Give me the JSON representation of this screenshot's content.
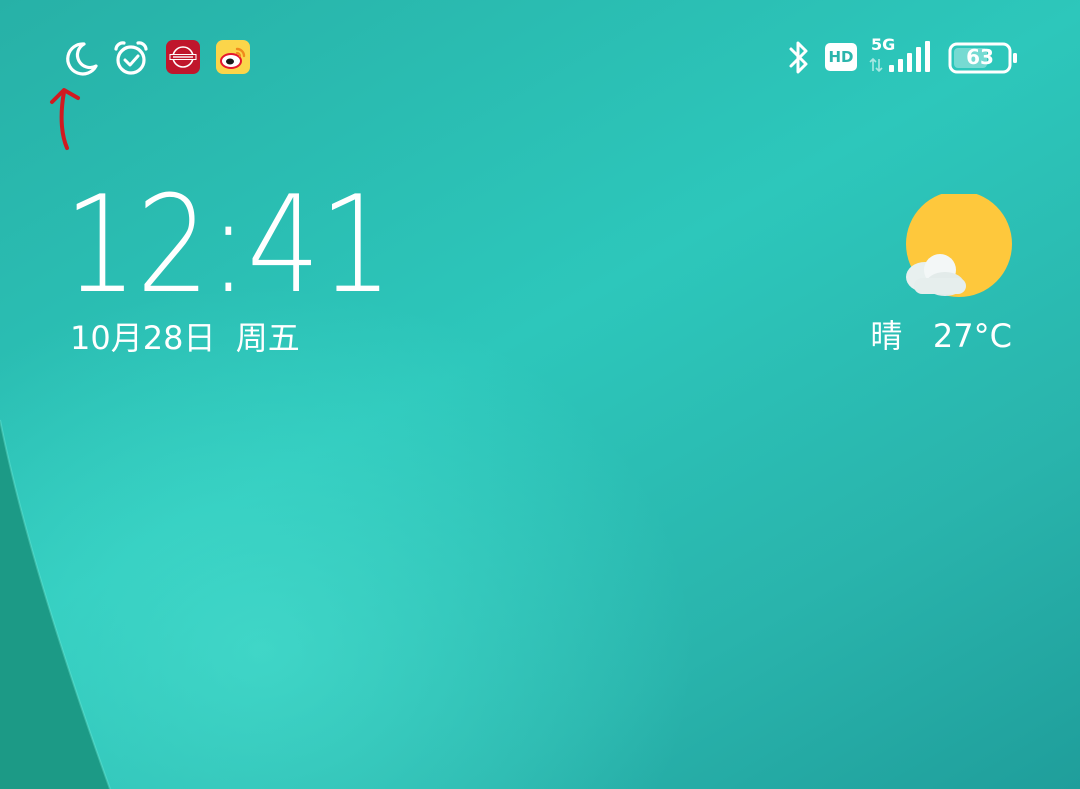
{
  "wallpaper": {
    "accent": "#2dc7bb",
    "dark_strip": "#1c9a86"
  },
  "status_bar": {
    "left_icons": [
      "moon-icon",
      "alarm-clock-icon",
      "nissan-app-icon",
      "weibo-app-icon"
    ],
    "right_icons": [
      "bluetooth-icon",
      "hd-voice-icon",
      "signal-bars-icon",
      "battery-icon"
    ],
    "hd_label": "HD",
    "network_type": "5G",
    "battery_level": "63",
    "battery_fraction": 0.63
  },
  "lockscreen": {
    "time": "12:41",
    "date": "10月28日  周五"
  },
  "weather": {
    "condition": "晴",
    "temperature": "27°C",
    "text": "晴   27°C",
    "icon": "sun-with-cloud-icon",
    "sun_color": "#fec83c"
  },
  "annotation": {
    "icon": "red-arrow-annotation",
    "color": "#d11a20"
  }
}
